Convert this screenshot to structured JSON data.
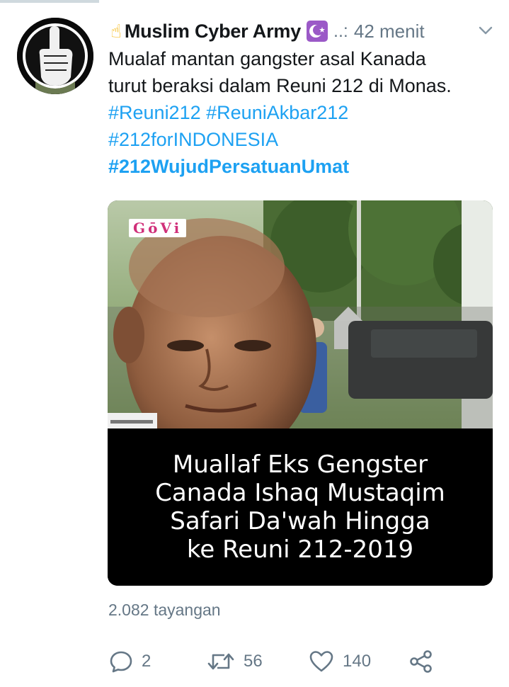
{
  "tweet": {
    "author": {
      "display_name": "Muslim Cyber Army",
      "handle_truncated": "..:",
      "timestamp": "42 menit"
    },
    "text_lines": [
      "Mualaf mantan gangster asal Kanada",
      "turut beraksi dalam Reuni 212 di Monas."
    ],
    "hashtags": {
      "reuni212": "#Reuni212",
      "reuni_akbar212": "#ReuniAkbar212",
      "for_indonesia": "#212forINDONESIA",
      "wujud_persatuan": "#212WujudPersatuanUmat"
    },
    "media": {
      "watermark": "GōVi",
      "caption_lines": [
        "Muallaf Eks Gengster",
        "Canada Ishaq Mustaqim",
        "Safari Da'wah Hingga",
        "ke Reuni 212-2019"
      ]
    },
    "views": "2.082 tayangan",
    "actions": {
      "replies": "2",
      "retweets": "56",
      "likes": "140"
    }
  },
  "colors": {
    "text": "#14171a",
    "secondary": "#657786",
    "link": "#1da1f2",
    "badge": "#9b59c7"
  },
  "icons": {
    "hand": "index-pointing-up-emoji",
    "badge": "star-and-crescent",
    "caret": "chevron-down-icon",
    "reply": "reply-bubble-icon",
    "retweet": "retweet-icon",
    "like": "heart-icon",
    "share": "share-icon"
  }
}
